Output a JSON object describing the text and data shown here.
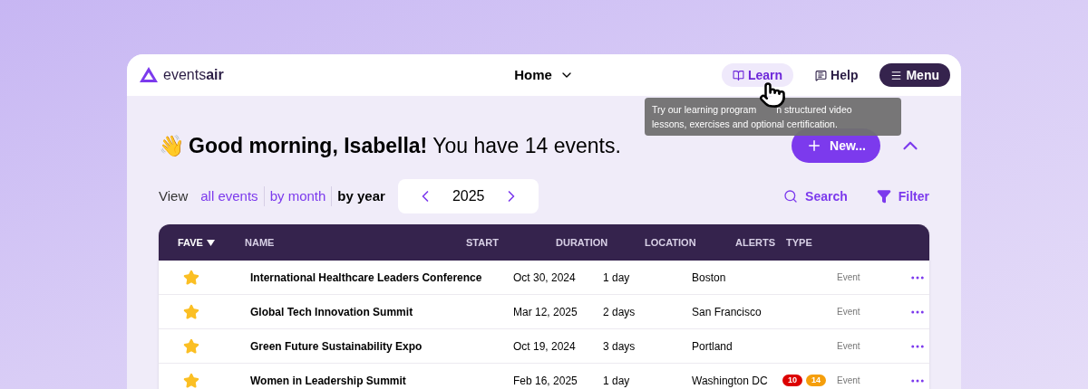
{
  "brand": {
    "name_a": "events",
    "name_b": "air"
  },
  "nav": {
    "title": "Home",
    "buttons": [
      {
        "label": "Learn",
        "selected": true
      },
      {
        "label": "Help",
        "selected": false
      },
      {
        "label": "Menu",
        "selected": false
      }
    ]
  },
  "tooltip": {
    "line1a": "Try our learning program",
    "line1b": "n structured video",
    "line2": "lessons, exercises and optional certification."
  },
  "greeting": {
    "wave": "👋",
    "bold": "Good morning, Isabella!",
    "rest": "You have 14 events."
  },
  "new_button": {
    "label": "New..."
  },
  "view": {
    "label": "View",
    "options": [
      {
        "label": "all events",
        "selected": false
      },
      {
        "label": "by month",
        "selected": false
      },
      {
        "label": "by year",
        "selected": true
      }
    ],
    "year": "2025"
  },
  "actions": [
    {
      "label": "Search",
      "kind": "search"
    },
    {
      "label": "Filter",
      "kind": "filter"
    }
  ],
  "table": {
    "columns": [
      "FAVE",
      "NAME",
      "START",
      "DURATION",
      "LOCATION",
      "ALERTS",
      "TYPE"
    ],
    "rows": [
      {
        "fave": true,
        "name": "International Healthcare Leaders Conference",
        "start": "Oct 30, 2024",
        "duration": "1 day",
        "location": "Boston",
        "alerts": [],
        "type": "Event"
      },
      {
        "fave": true,
        "name": "Global Tech Innovation Summit",
        "start": "Mar 12, 2025",
        "duration": "2 days",
        "location": "San Francisco",
        "alerts": [],
        "type": "Event"
      },
      {
        "fave": true,
        "name": "Green Future Sustainability Expo",
        "start": "Oct 19, 2024",
        "duration": "3 days",
        "location": "Portland",
        "alerts": [],
        "type": "Event"
      },
      {
        "fave": true,
        "name": "Women in Leadership Summit",
        "start": "Feb 16, 2025",
        "duration": "1 day",
        "location": "Washington DC",
        "alerts": [
          {
            "text": "10",
            "color": "#dc0000"
          },
          {
            "text": "14",
            "color": "#f59e0b"
          }
        ],
        "type": "Event"
      }
    ]
  }
}
